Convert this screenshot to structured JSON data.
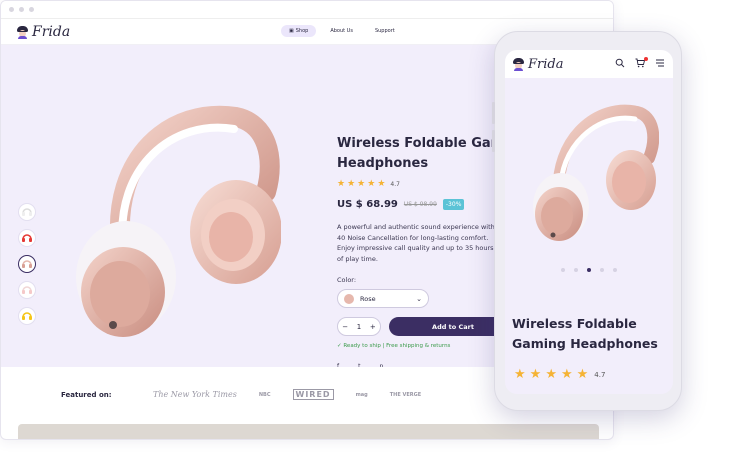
{
  "brand": {
    "name": "Frida"
  },
  "nav": {
    "items": [
      {
        "label": "Shop",
        "icon": "bag-icon",
        "active": true
      },
      {
        "label": "About Us"
      },
      {
        "label": "Support"
      }
    ]
  },
  "product": {
    "title_line1": "Wireless Foldable Gaming",
    "title_line2": "Headphones",
    "rating": "4.7",
    "price": "US $ 68.99",
    "old_price": "US $ 98.99",
    "discount": "-30%",
    "description": "A powerful and authentic sound experience with 40 Noise Cancellation for long-lasting comfort. Enjoy impressive call quality and up to 35 hours of play time.",
    "color_label": "Color:",
    "color_value": "Rose",
    "quantity": "1",
    "qty_minus": "−",
    "qty_plus": "+",
    "add_to_cart": "Add to Cart",
    "shipping": "✓ Ready to ship | Free shipping & returns",
    "social": [
      "f",
      "t",
      "p"
    ]
  },
  "featured": {
    "label": "Featured on:",
    "publications": [
      "The New York Times",
      "NBC",
      "WIRED",
      "mag",
      "THE VERGE"
    ]
  },
  "phone": {
    "title_line1": "Wireless Foldable",
    "title_line2": "Gaming Headphones",
    "rating": "4.7"
  },
  "colors": {
    "accent": "#3b2e63",
    "hero_bg": "#f2eefb",
    "rose": "#e6b8ad",
    "star": "#f5b335",
    "discount": "#5bc3d6",
    "ship": "#3a9a4a"
  }
}
